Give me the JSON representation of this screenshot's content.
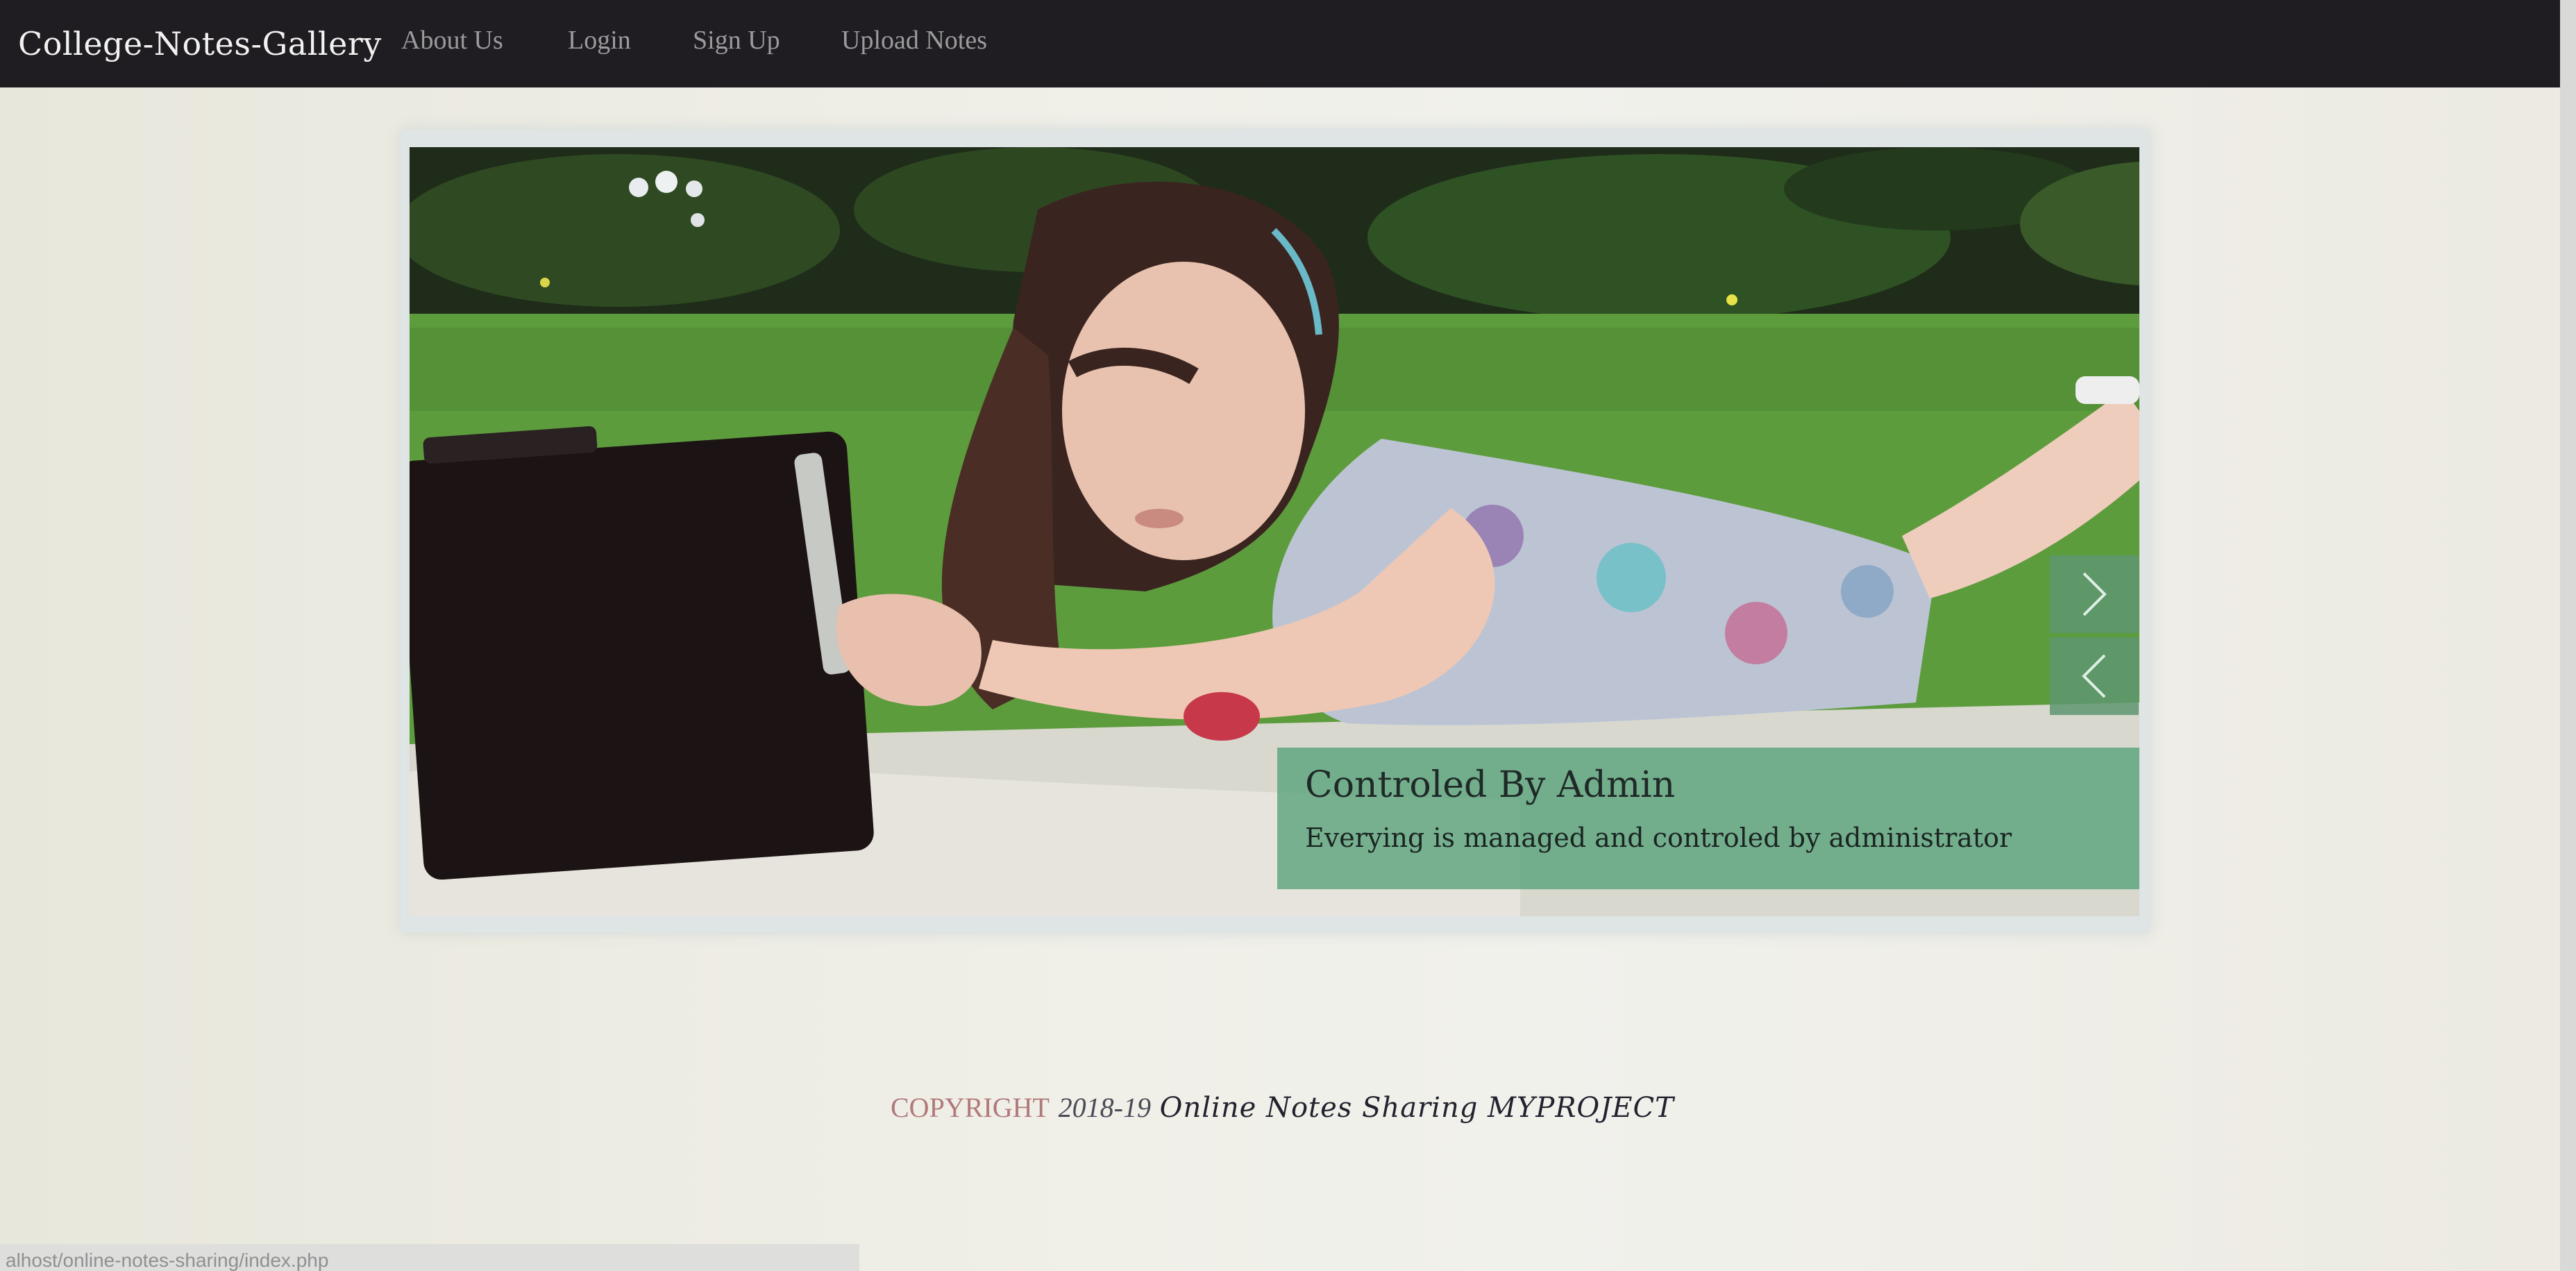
{
  "navbar": {
    "brand": "College-Notes-Gallery",
    "links": [
      "About Us",
      "Login",
      "Sign Up",
      "Upload Notes"
    ]
  },
  "slider": {
    "image_description_icon": "slide-photo",
    "caption_title": "Controled By Admin",
    "caption_text": "Everying is managed and controled by administrator",
    "next_icon": "chevron-right-icon",
    "prev_icon": "chevron-left-icon"
  },
  "footer": {
    "copyright": "COPYRIGHT",
    "years": "2018-19",
    "project": "Online Notes Sharing MYPROJECT"
  },
  "status_bar": {
    "url": "alhost/online-notes-sharing/index.php"
  },
  "colors": {
    "navbar_bg": "#1f1d22",
    "caption_bg": "#5da57c",
    "copyright_accent": "#b0797a"
  }
}
